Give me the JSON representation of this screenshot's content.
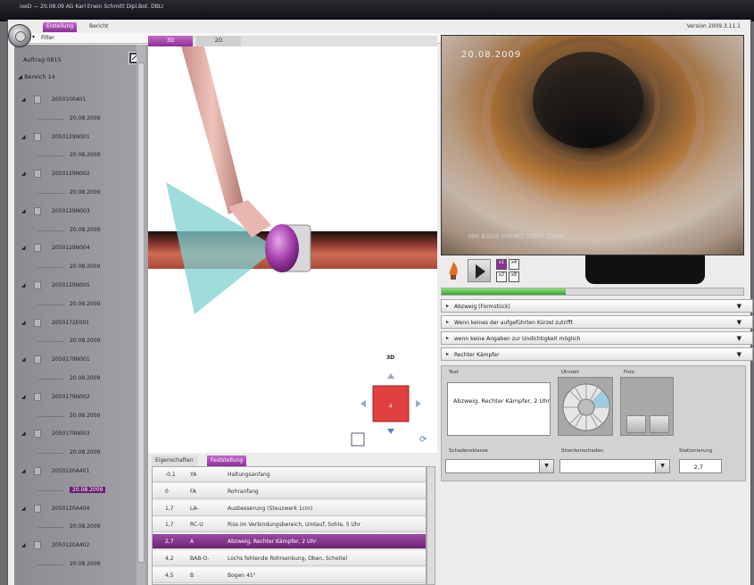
{
  "window": {
    "title": "ixeD — 20.08.09 AG Karl Erwin Schmitt Dipl.Bot. DBLI"
  },
  "menu": {
    "tabs": [
      {
        "label": "Erstellung",
        "active": true
      },
      {
        "label": "Bericht",
        "active": false
      }
    ],
    "version": "Version 2009.3.11.1",
    "filter_label": "Filter"
  },
  "tree": {
    "auftrag": "Auftrag 0815",
    "bereich": "Bereich 14",
    "items": [
      {
        "label": "2050100401",
        "kind": "node"
      },
      {
        "label": "20.08.2009",
        "kind": "date"
      },
      {
        "label": "2050129N001",
        "kind": "node"
      },
      {
        "label": "20.08.2009",
        "kind": "date"
      },
      {
        "label": "2050129N002",
        "kind": "node"
      },
      {
        "label": "20.08.2009",
        "kind": "date"
      },
      {
        "label": "2050129N003",
        "kind": "node"
      },
      {
        "label": "20.08.2009",
        "kind": "date"
      },
      {
        "label": "2050129N004",
        "kind": "node"
      },
      {
        "label": "20.08.2009",
        "kind": "date"
      },
      {
        "label": "2050129N005",
        "kind": "node"
      },
      {
        "label": "20.08.2009",
        "kind": "date"
      },
      {
        "label": "2050172E001",
        "kind": "node"
      },
      {
        "label": "20.08.2009",
        "kind": "date"
      },
      {
        "label": "2050179N001",
        "kind": "node"
      },
      {
        "label": "20.08.2009",
        "kind": "date"
      },
      {
        "label": "2050179N002",
        "kind": "node"
      },
      {
        "label": "20.08.2009",
        "kind": "date"
      },
      {
        "label": "2050179N003",
        "kind": "node"
      },
      {
        "label": "20.08.2009",
        "kind": "date"
      },
      {
        "label": "2050120A401",
        "kind": "node"
      },
      {
        "label": "20.08.2009",
        "kind": "date",
        "selected": true
      },
      {
        "label": "2050120A404",
        "kind": "node"
      },
      {
        "label": "20.08.2009",
        "kind": "date"
      },
      {
        "label": "2050120A402",
        "kind": "node"
      },
      {
        "label": "20.08.2009",
        "kind": "date"
      }
    ]
  },
  "view": {
    "tabs": [
      {
        "label": "3D",
        "active": true
      },
      {
        "label": "2D",
        "active": false
      }
    ],
    "orientation_label": "3D"
  },
  "observations": {
    "tabs": [
      {
        "label": "Eigenschaften",
        "active": false
      },
      {
        "label": "Feststellung",
        "active": true
      }
    ],
    "rows": [
      {
        "station": "-0,1",
        "code": "YA",
        "text": "Haltungsanfang"
      },
      {
        "station": "0",
        "code": "FA",
        "text": "Rohranfang"
      },
      {
        "station": "1,7",
        "code": "LA-",
        "text": "Ausbesserung (Steuzwerk 1cm)"
      },
      {
        "station": "1,7",
        "code": "RC-U",
        "text": "Riss im Verbindungsbereich, Umlauf, Sohle, 5 Uhr"
      },
      {
        "station": "2,7",
        "code": "A",
        "text": "Abzweig, Rechter Kämpfer, 2 Uhr",
        "selected": true
      },
      {
        "station": "4,2",
        "code": "BAB-O-",
        "text": "Lochs fehlende Rohrsenkung, Oben, Scheitel"
      },
      {
        "station": "4,5",
        "code": "B",
        "text": "Bogen 45°"
      }
    ]
  },
  "video": {
    "date": "20.08.2009",
    "caption": "MM BASIS HYDRO TEAM 10000",
    "progress": 0.41
  },
  "controls": {
    "small_buttons": [
      "x1",
      "x4",
      "x2",
      "x8"
    ]
  },
  "dropdowns": [
    {
      "text": "Abzweig (Formstück)"
    },
    {
      "text": "Wenn keines der aufgeführten Kürzel zutrifft"
    },
    {
      "text": "wenn keine Angaben zur Undichtigkeit möglich"
    },
    {
      "text": "Rechter Kämpfer"
    }
  ],
  "details": {
    "text_label": "Text",
    "text_value": "Abzweig, Rechter Kämpfer, 2 Uhr",
    "clock_label": "Uhrzeit",
    "foto_label": "Foto",
    "schadensklasse_label": "Schadensklasse",
    "streckenschaden_label": "Streckenschaden",
    "stationierung_label": "Stationierung",
    "stationierung_value": "2,7"
  }
}
